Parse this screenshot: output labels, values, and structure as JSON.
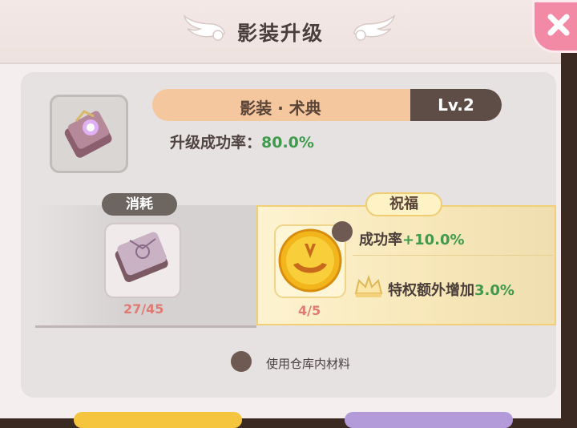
{
  "header": {
    "title": "影装升级"
  },
  "item": {
    "name": "影装 · 术典",
    "level": "Lv.2",
    "success_rate_label": "升级成功率：",
    "success_rate_value": "80.0%"
  },
  "consume": {
    "tag": "消耗",
    "count": "27/45"
  },
  "blessing": {
    "tag": "祝福",
    "count": "4/5",
    "bonus1_label": "成功率",
    "bonus1_value": "+10.0%",
    "bonus2_label": "特权额外增加",
    "bonus2_value": "3.0%"
  },
  "warehouse": {
    "label": "使用仓库内材料"
  },
  "colors": {
    "accent_green": "#3f9a4d",
    "count_red": "#e07a72",
    "name_bar": "#f5c79f",
    "level_box": "#5e4c47",
    "close_pink": "#f28aa5"
  }
}
